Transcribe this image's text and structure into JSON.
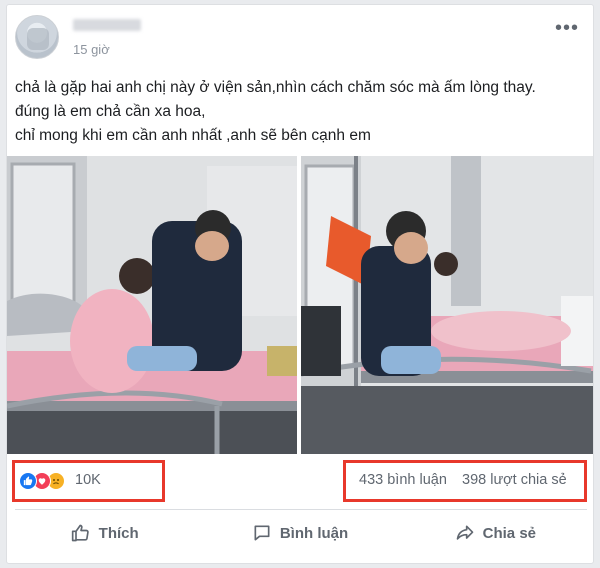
{
  "post": {
    "time": "15 giờ",
    "text_lines": [
      "chả là gặp hai anh chị này ở viện sản,nhìn cách chăm sóc mà ấm lòng thay.",
      "đúng là em chả cần xa hoa,",
      "chỉ mong khi em cần anh nhất ,anh sẽ bên cạnh em"
    ]
  },
  "stats": {
    "reaction_icons": [
      "like-icon",
      "love-icon",
      "sad-icon"
    ],
    "reaction_count": "10K",
    "comments": "433 bình luận",
    "shares": "398 lượt chia sẻ"
  },
  "actions": {
    "like": "Thích",
    "comment": "Bình luận",
    "share": "Chia sẻ"
  },
  "colors": {
    "highlight_box": "#e8382b",
    "muted_text": "#606770",
    "like_blue": "#1877f2",
    "love_red": "#f33e58",
    "sad_yellow": "#f7b125"
  }
}
